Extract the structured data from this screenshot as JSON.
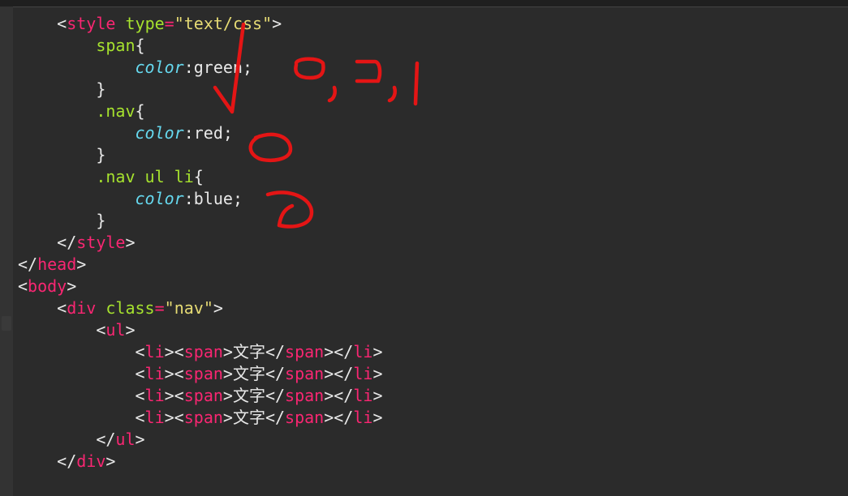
{
  "code": {
    "lines": [
      {
        "indent": 1,
        "tokens": [
          {
            "t": "pnc",
            "v": "<"
          },
          {
            "t": "tag",
            "v": "style"
          },
          {
            "t": "txt",
            "v": " "
          },
          {
            "t": "attr",
            "v": "type"
          },
          {
            "t": "op",
            "v": "="
          },
          {
            "t": "str",
            "v": "\"text/css\""
          },
          {
            "t": "pnc",
            "v": ">"
          }
        ]
      },
      {
        "indent": 2,
        "tokens": [
          {
            "t": "sel",
            "v": "span"
          },
          {
            "t": "pnc",
            "v": "{"
          }
        ]
      },
      {
        "indent": 3,
        "tokens": [
          {
            "t": "prop",
            "v": "color"
          },
          {
            "t": "pnc",
            "v": ":"
          },
          {
            "t": "val",
            "v": "green"
          },
          {
            "t": "pnc",
            "v": ";"
          }
        ]
      },
      {
        "indent": 2,
        "tokens": [
          {
            "t": "pnc",
            "v": "}"
          }
        ]
      },
      {
        "indent": 2,
        "tokens": [
          {
            "t": "sel",
            "v": ".nav"
          },
          {
            "t": "pnc",
            "v": "{"
          }
        ]
      },
      {
        "indent": 3,
        "tokens": [
          {
            "t": "prop",
            "v": "color"
          },
          {
            "t": "pnc",
            "v": ":"
          },
          {
            "t": "val",
            "v": "red"
          },
          {
            "t": "pnc",
            "v": ";"
          }
        ]
      },
      {
        "indent": 2,
        "tokens": [
          {
            "t": "pnc",
            "v": "}"
          }
        ]
      },
      {
        "indent": 2,
        "tokens": [
          {
            "t": "sel",
            "v": ".nav ul li"
          },
          {
            "t": "pnc",
            "v": "{"
          }
        ]
      },
      {
        "indent": 3,
        "tokens": [
          {
            "t": "prop",
            "v": "color"
          },
          {
            "t": "pnc",
            "v": ":"
          },
          {
            "t": "val",
            "v": "blue"
          },
          {
            "t": "pnc",
            "v": ";"
          }
        ]
      },
      {
        "indent": 2,
        "tokens": [
          {
            "t": "pnc",
            "v": "}"
          }
        ]
      },
      {
        "indent": 1,
        "tokens": [
          {
            "t": "pnc",
            "v": "</"
          },
          {
            "t": "tag",
            "v": "style"
          },
          {
            "t": "pnc",
            "v": ">"
          }
        ]
      },
      {
        "indent": 0,
        "tokens": [
          {
            "t": "pnc",
            "v": "</"
          },
          {
            "t": "tag",
            "v": "head"
          },
          {
            "t": "pnc",
            "v": ">"
          }
        ]
      },
      {
        "indent": 0,
        "tokens": [
          {
            "t": "pnc",
            "v": "<"
          },
          {
            "t": "tag",
            "v": "body"
          },
          {
            "t": "pnc",
            "v": ">"
          }
        ]
      },
      {
        "indent": 1,
        "tokens": [
          {
            "t": "pnc",
            "v": "<"
          },
          {
            "t": "tag",
            "v": "div"
          },
          {
            "t": "txt",
            "v": " "
          },
          {
            "t": "attr",
            "v": "class"
          },
          {
            "t": "op",
            "v": "="
          },
          {
            "t": "str",
            "v": "\"nav\""
          },
          {
            "t": "pnc",
            "v": ">"
          }
        ]
      },
      {
        "indent": 2,
        "tokens": [
          {
            "t": "pnc",
            "v": "<"
          },
          {
            "t": "tag",
            "v": "ul"
          },
          {
            "t": "pnc",
            "v": ">"
          }
        ]
      },
      {
        "indent": 3,
        "tokens": [
          {
            "t": "pnc",
            "v": "<"
          },
          {
            "t": "tag",
            "v": "li"
          },
          {
            "t": "pnc",
            "v": "><"
          },
          {
            "t": "tag",
            "v": "span"
          },
          {
            "t": "pnc",
            "v": ">"
          },
          {
            "t": "txt",
            "v": "文字"
          },
          {
            "t": "pnc",
            "v": "</"
          },
          {
            "t": "tag",
            "v": "span"
          },
          {
            "t": "pnc",
            "v": "></"
          },
          {
            "t": "tag",
            "v": "li"
          },
          {
            "t": "pnc",
            "v": ">"
          }
        ]
      },
      {
        "indent": 3,
        "tokens": [
          {
            "t": "pnc",
            "v": "<"
          },
          {
            "t": "tag",
            "v": "li"
          },
          {
            "t": "pnc",
            "v": "><"
          },
          {
            "t": "tag",
            "v": "span"
          },
          {
            "t": "pnc",
            "v": ">"
          },
          {
            "t": "txt",
            "v": "文字"
          },
          {
            "t": "pnc",
            "v": "</"
          },
          {
            "t": "tag",
            "v": "span"
          },
          {
            "t": "pnc",
            "v": "></"
          },
          {
            "t": "tag",
            "v": "li"
          },
          {
            "t": "pnc",
            "v": ">"
          }
        ]
      },
      {
        "indent": 3,
        "tokens": [
          {
            "t": "pnc",
            "v": "<"
          },
          {
            "t": "tag",
            "v": "li"
          },
          {
            "t": "pnc",
            "v": "><"
          },
          {
            "t": "tag",
            "v": "span"
          },
          {
            "t": "pnc",
            "v": ">"
          },
          {
            "t": "txt",
            "v": "文字"
          },
          {
            "t": "pnc",
            "v": "</"
          },
          {
            "t": "tag",
            "v": "span"
          },
          {
            "t": "pnc",
            "v": "></"
          },
          {
            "t": "tag",
            "v": "li"
          },
          {
            "t": "pnc",
            "v": ">"
          }
        ]
      },
      {
        "indent": 3,
        "tokens": [
          {
            "t": "pnc",
            "v": "<"
          },
          {
            "t": "tag",
            "v": "li"
          },
          {
            "t": "pnc",
            "v": "><"
          },
          {
            "t": "tag",
            "v": "span"
          },
          {
            "t": "pnc",
            "v": ">"
          },
          {
            "t": "txt",
            "v": "文字"
          },
          {
            "t": "pnc",
            "v": "</"
          },
          {
            "t": "tag",
            "v": "span"
          },
          {
            "t": "pnc",
            "v": "></"
          },
          {
            "t": "tag",
            "v": "li"
          },
          {
            "t": "pnc",
            "v": ">"
          }
        ]
      },
      {
        "indent": 2,
        "tokens": [
          {
            "t": "pnc",
            "v": "</"
          },
          {
            "t": "tag",
            "v": "ul"
          },
          {
            "t": "pnc",
            "v": ">"
          }
        ]
      },
      {
        "indent": 1,
        "tokens": [
          {
            "t": "pnc",
            "v": "</"
          },
          {
            "t": "tag",
            "v": "div"
          },
          {
            "t": "pnc",
            "v": ">"
          }
        ]
      }
    ]
  },
  "annotations": {
    "color": "#e41515",
    "shapes": [
      {
        "name": "checkmark-arrow",
        "type": "path"
      },
      {
        "name": "small-loop-a",
        "type": "path"
      },
      {
        "name": "comma-a",
        "type": "path"
      },
      {
        "name": "small-loop-b",
        "type": "path"
      },
      {
        "name": "comma-b",
        "type": "path"
      },
      {
        "name": "vertical-tick",
        "type": "path"
      },
      {
        "name": "circle-after-red",
        "type": "path"
      },
      {
        "name": "hook-after-blue",
        "type": "path"
      }
    ]
  }
}
